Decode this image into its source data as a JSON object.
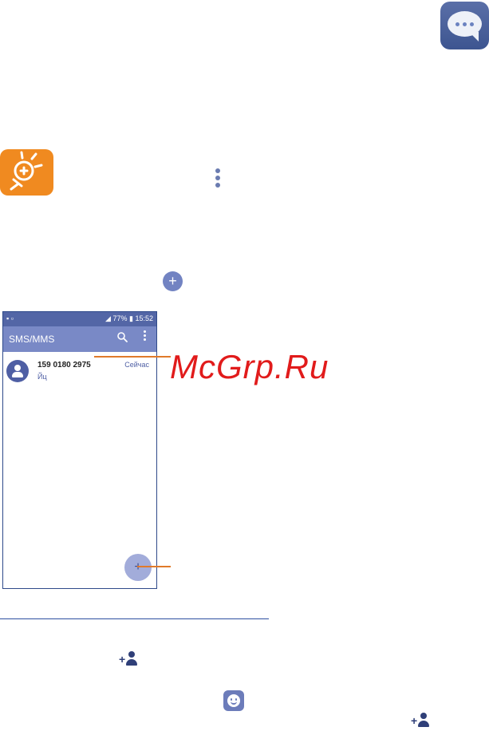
{
  "status_bar": {
    "battery": "77%",
    "time": "15:52"
  },
  "app_bar": {
    "title": "SMS/MMS"
  },
  "conversation": {
    "name": "159 0180 2975",
    "snippet": "Йц",
    "time": "Сейчас"
  },
  "fab": {
    "symbol": "+"
  },
  "inline_plus": {
    "symbol": "+"
  },
  "watermark": "McGrp.Ru",
  "icons": {
    "app": "messaging-app-icon",
    "tip": "lightbulb-icon",
    "menu": "more-vertical-icon",
    "new_message": "plus-circle-icon",
    "search": "search-icon",
    "add_contact": "add-contact-icon",
    "emoji": "emoji-icon"
  },
  "colors": {
    "status_bar": "#5366a6",
    "app_bar": "#7989c6",
    "accent": "#4f5fa4",
    "callout": "#e07a2a",
    "tip": "#f08a20",
    "watermark": "#e11b1b"
  }
}
